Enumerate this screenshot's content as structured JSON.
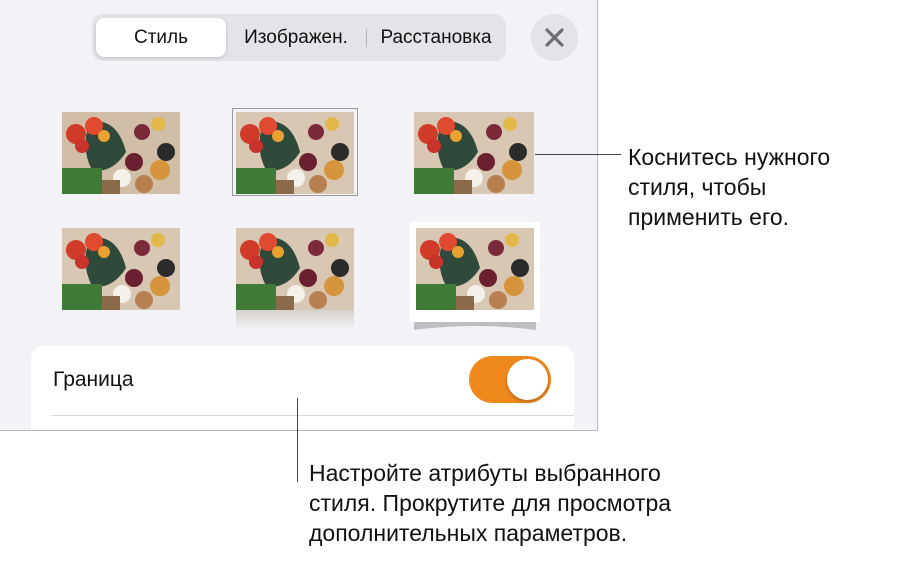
{
  "tabs": {
    "style": "Стиль",
    "image": "Изображен.",
    "arrange": "Расстановка"
  },
  "border_row": {
    "label": "Граница",
    "toggle_on": true
  },
  "callouts": {
    "top": [
      "Коснитесь нужного",
      "стиля, чтобы",
      "применить его."
    ],
    "bottom": [
      "Настройте атрибуты выбранного",
      "стиля. Прокрутите для просмотра",
      "дополнительных параметров."
    ]
  },
  "colors": {
    "accent": "#f0891c",
    "panel_bg": "#f2f2f7"
  }
}
